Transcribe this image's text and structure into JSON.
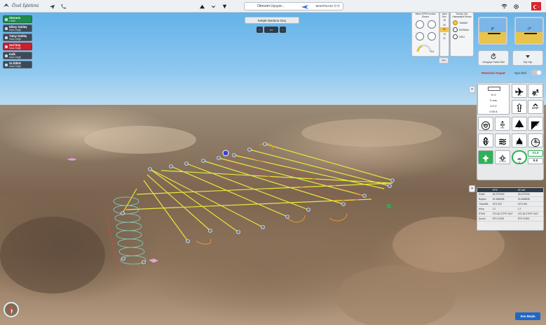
{
  "header": {
    "logo_text": "Özel İşletimi",
    "status_text": "Otonom Uçuyor...",
    "status_right": "MANTIKASI ⓪⓪",
    "flag_icon": "turkey-flag-icon"
  },
  "modes": [
    {
      "label": "Otonom",
      "sub": "• Aktif"
    },
    {
      "label": "Dikey Güdüş",
      "sub": "Hazır Değil"
    },
    {
      "label": "Yatay Güdüş",
      "sub": "Hazır Değil"
    },
    {
      "label": "Acil İniş",
      "sub": "Hazır Değil"
    },
    {
      "label": "Kalk",
      "sub": "Hazır Değil"
    },
    {
      "label": "GLİDİER",
      "sub": "Hazır Değil"
    }
  ],
  "kokpit": {
    "label": "Kokpit Moduna Geç",
    "ctrl_mid": "•••"
  },
  "motor_panel": {
    "title": "Motor RPM Kontrol Ekranı",
    "value": "9.6"
  },
  "yakit_panel": {
    "title": "Yakıt Sev.",
    "nums": [
      "15",
      "25",
      "50",
      "13",
      "21"
    ]
  },
  "donus_panel": {
    "title": "Dönüş Yön Hassasiyet Ekranı",
    "options": [
      "TAMAM",
      "NORMAL",
      "HIZLI"
    ]
  },
  "attitude": {
    "left": "0°",
    "right": "-7°"
  },
  "controls": {
    "gps_label": "Gps Aktif",
    "motor_off": "Motorları Kapat",
    "left_btn": "Döngüye Farklı Etki",
    "right_btn": "İniş Yap"
  },
  "telemetry": {
    "battery_percent": "% 0",
    "battery_level": 0,
    "battery_time": "0 min",
    "battery_voltage": "0.0 V",
    "battery_current": "0.00 A",
    "tiles": [
      {
        "val": "21.0",
        "unit": "m/s"
      },
      {
        "val": "20.9",
        "unit": "m/s"
      },
      {
        "val": "3.0",
        "unit": "m/s"
      },
      {
        "val": "172°",
        "unit": ""
      },
      {
        "val": "100",
        "unit": "%"
      },
      {
        "val": "0.0",
        "unit": "m/s"
      },
      {
        "val": "104",
        "unit": "m"
      },
      {
        "val": "211°",
        "unit": ""
      },
      {
        "val": "834",
        "unit": "m"
      },
      {
        "val": "2.1",
        "unit": "m/s"
      },
      {
        "val": "31.1",
        "unit": "ATLAS"
      },
      {
        "val": "22",
        "unit": "°C"
      },
      {
        "val": "20",
        "unit": "3/8"
      },
      {
        "val": "17",
        "unit": "ATLAS"
      },
      {
        "val": "45",
        "unit": "m"
      },
      {
        "val": "21.0",
        "unit": ""
      },
      {
        "val": "0.0",
        "unit": ""
      }
    ]
  },
  "gps_table": {
    "headers": [
      "",
      "GPS",
      "ATLAS"
    ],
    "rows": [
      [
        "Enlem",
        "38.2279230",
        "38.2279230"
      ],
      [
        "Boylam",
        "39.4836838",
        "39.4836838"
      ],
      [
        "Yükseklik",
        "1671.000",
        "1671.000"
      ],
      [
        "Hdop",
        "1.2",
        "1.2"
      ],
      [
        "RTKM",
        "2TG 8Z 2TFFF 0027",
        "2TG 8Z 2TFFF 0027"
      ],
      [
        "Durum",
        "RTK FIXED",
        "RTK FIXED"
      ]
    ]
  },
  "zoom_label": "Zoo Başla"
}
